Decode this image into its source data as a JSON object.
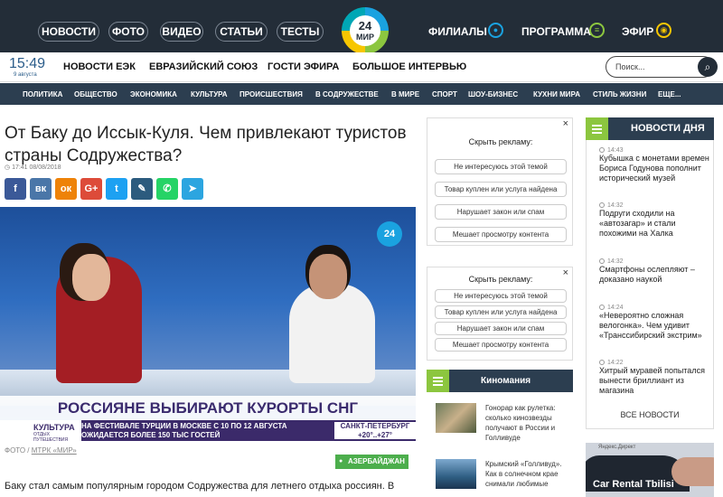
{
  "top_nav": {
    "items": [
      "НОВОСТИ",
      "ФОТО",
      "ВИДЕО",
      "СТАТЬИ",
      "ТЕСТЫ"
    ],
    "logo_top": "24",
    "logo_bottom": "МИР",
    "right": {
      "branches": "ФИЛИАЛЫ",
      "program": "ПРОГРАММА",
      "live": "ЭФИР"
    }
  },
  "clock": {
    "time": "15:49",
    "date": "9 августа"
  },
  "secondary_nav": [
    "НОВОСТИ ЕЭК",
    "ЕВРАЗИЙСКИЙ СОЮЗ",
    "ГОСТИ ЭФИРА",
    "БОЛЬШОЕ ИНТЕРВЬЮ"
  ],
  "search": {
    "placeholder": "Поиск..."
  },
  "categories": [
    "ПОЛИТИКА",
    "ОБЩЕСТВО",
    "ЭКОНОМИКА",
    "КУЛЬТУРА",
    "ПРОИСШЕСТВИЯ",
    "В СОДРУЖЕСТВЕ",
    "В МИРЕ",
    "СПОРТ",
    "ШОУ-БИЗНЕС",
    "КУХНИ МИРА",
    "СТИЛЬ ЖИЗНИ",
    "ЕЩЕ..."
  ],
  "article": {
    "title": "От Баку до Иссык-Куля. Чем привлекают туристов страны Содружества?",
    "time": "17:41 08/08/2018",
    "photo_label": "ФОТО",
    "photo_source": "МТРК «МИР»",
    "country_tag": "АЗЕРБАЙДЖАН",
    "body": "Баку стал самым популярным городом Содружества для летнего отдыха россиян. В"
  },
  "share_buttons": [
    {
      "icon": "facebook-icon",
      "glyph": "f",
      "color": "#3b5998"
    },
    {
      "icon": "vk-icon",
      "glyph": "вк",
      "color": "#4a76a8"
    },
    {
      "icon": "odnoklassniki-icon",
      "glyph": "ок",
      "color": "#ee8208"
    },
    {
      "icon": "google-plus-icon",
      "glyph": "G+",
      "color": "#dd4b39"
    },
    {
      "icon": "twitter-icon",
      "glyph": "t",
      "color": "#1da1f2"
    },
    {
      "icon": "livejournal-icon",
      "glyph": "✎",
      "color": "#2c5b7e"
    },
    {
      "icon": "whatsapp-icon",
      "glyph": "✆",
      "color": "#25d366"
    },
    {
      "icon": "telegram-icon",
      "glyph": "➤",
      "color": "#2ca5e0"
    }
  ],
  "video": {
    "channel_logo": "24",
    "banner": "РОССИЯНЕ ВЫБИРАЮТ КУРОРТЫ СНГ",
    "ticker_section": "КУЛЬТУРА",
    "ticker_section_sub": "ОТДЫХ ПУТЕШЕСТВИЯ",
    "ticker_text": "НА ФЕСТИВАЛЕ ТУРЦИИ В МОСКВЕ С 10 ПО 12 АВГУСТА ОЖИДАЕТСЯ БОЛЕЕ 150 ТЫС ГОСТЕЙ",
    "ticker_city": "САНКТ-ПЕТЕРБУРГ",
    "ticker_weather": "+20°..+27°"
  },
  "ad_feedback": {
    "title": "Скрыть рекламу:",
    "close": "×",
    "options": [
      "Не интересуюсь этой темой",
      "Товар куплен или услуга найдена",
      "Нарушает закон или спам",
      "Мешает просмотру контента"
    ]
  },
  "kinomania": {
    "title": "Киномания",
    "items": [
      "Гонорар как рулетка: сколько кинозвезды получают в России и Голливуде",
      "Крымский «Голливуд». Как в солнечном крае снимали любимые"
    ]
  },
  "news_of_day": {
    "title": "НОВОСТИ ДНЯ",
    "items": [
      {
        "time": "14:43",
        "text": "Кубышка с монетами времен Бориса Годунова пополнит исторический музей"
      },
      {
        "time": "14:32",
        "text": "Подруги сходили на «автозагар» и стали похожими на Халка"
      },
      {
        "time": "14:32",
        "text": "Смартфоны ослепляют – доказано наукой"
      },
      {
        "time": "14:24",
        "text": "«Невероятно сложная велогонка». Чем удивит «Транссибирский экстрим»"
      },
      {
        "time": "14:22",
        "text": "Хитрый муравей попытался вынести бриллиант из магазина"
      }
    ],
    "all_label": "ВСЕ НОВОСТИ"
  },
  "yandex_ad": {
    "label": "Яндекс.Директ",
    "text": "Car Rental Tbilisi"
  }
}
